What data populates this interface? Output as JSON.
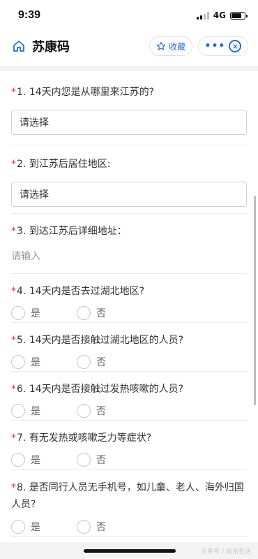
{
  "status_bar": {
    "time": "9:39",
    "network": "4G"
  },
  "nav": {
    "title": "苏康码",
    "favorite_label": "收藏",
    "more_label": "•••"
  },
  "questions": [
    {
      "number": "1.",
      "text": "14天内您是从哪里来江苏的?",
      "type": "select",
      "value": "请选择"
    },
    {
      "number": "2.",
      "text": "到江苏后居住地区:",
      "type": "select",
      "value": "请选择"
    },
    {
      "number": "3.",
      "text": "到达江苏后详细地址：",
      "type": "text",
      "placeholder": "请输入"
    },
    {
      "number": "4.",
      "text": "14天内是否去过湖北地区?",
      "type": "radio",
      "options": [
        "是",
        "否"
      ]
    },
    {
      "number": "5.",
      "text": "14天内是否接触过湖北地区的人员?",
      "type": "radio",
      "options": [
        "是",
        "否"
      ]
    },
    {
      "number": "6.",
      "text": "14天内是否接触过发热咳嗽的人员?",
      "type": "radio",
      "options": [
        "是",
        "否"
      ]
    },
    {
      "number": "7.",
      "text": "有无发热或咳嗽乏力等症状?",
      "type": "radio",
      "options": [
        "是",
        "否"
      ]
    },
    {
      "number": "8.",
      "text": "是否同行人员无手机号，如儿童、老人、海外归国人员?",
      "type": "radio",
      "options": [
        "是",
        "否"
      ]
    }
  ],
  "required_mark": "*",
  "watermark": "头条号 / 南京生活",
  "colors": {
    "accent": "#1f6fe0",
    "required": "#e33333"
  }
}
